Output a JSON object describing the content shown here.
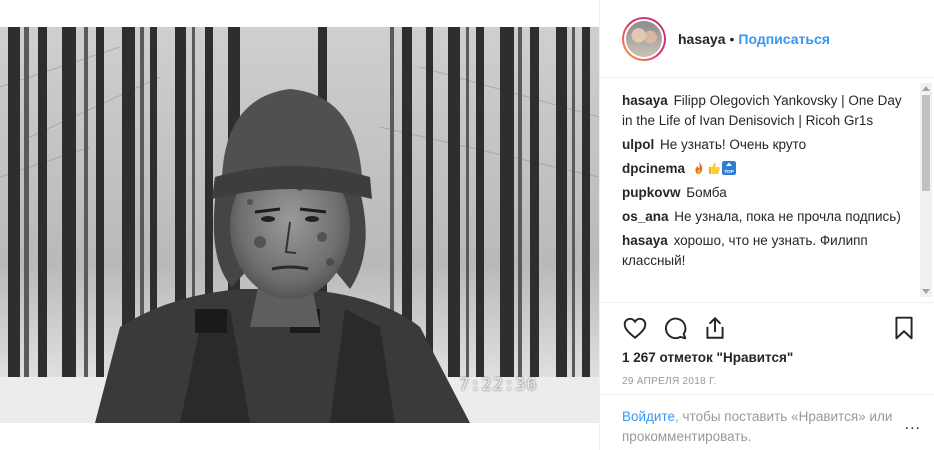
{
  "post": {
    "username": "hasaya",
    "separator": "•",
    "follow_label": "Подписаться",
    "photo_timestamp": "7:22:36"
  },
  "comments": [
    {
      "user": "hasaya",
      "text": "Filipp Olegovich Yankovsky | One Day in the Life of Ivan Denisovich | Ricoh Gr1s"
    },
    {
      "user": "ulpol",
      "text": "Не узнать! Очень круто"
    },
    {
      "user": "dpcinema",
      "text": "",
      "emoji": [
        "fire-emoji",
        "thumbs-up-emoji",
        "top-emoji"
      ],
      "emoji_top_text": "TOP"
    },
    {
      "user": "pupkovw",
      "text": "Бомба"
    },
    {
      "user": "os_ana",
      "text": "Не узнала, пока не прочла подпись)"
    },
    {
      "user": "hasaya",
      "text": "хорошо, что не узнать. Филипп классный!"
    }
  ],
  "actions": {
    "like_icon": "heart-icon",
    "comment_icon": "comment-icon",
    "share_icon": "share-icon",
    "save_icon": "bookmark-icon"
  },
  "likes_text": "1 267 отметок \"Нравится\"",
  "date_text": "29 АПРЕЛЯ 2018 Г.",
  "login_prompt": {
    "link": "Войдите",
    "rest": ", чтобы поставить «Нравится» или прокомментировать.",
    "more": "..."
  },
  "colors": {
    "accent": "#3897f0",
    "text": "#262626",
    "muted": "#999999",
    "border": "#efefef"
  }
}
